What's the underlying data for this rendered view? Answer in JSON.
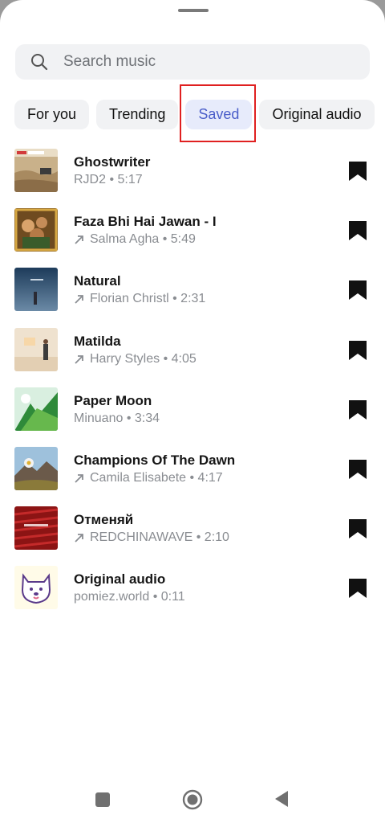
{
  "search": {
    "placeholder": "Search music",
    "icon": "search-icon"
  },
  "tabs": [
    {
      "label": "For you"
    },
    {
      "label": "Trending"
    },
    {
      "label": "Saved",
      "active": true
    },
    {
      "label": "Original audio"
    }
  ],
  "tracks": [
    {
      "title": "Ghostwriter",
      "trending": false,
      "subtitle": "RJD2 • 5:17",
      "art": "ghostwriter-cover"
    },
    {
      "title": "Faza Bhi Hai Jawan - I",
      "trending": true,
      "subtitle": "Salma Agha • 5:49",
      "art": "faza-cover"
    },
    {
      "title": "Natural",
      "trending": true,
      "subtitle": "Florian Christl • 2:31",
      "art": "natural-cover"
    },
    {
      "title": "Matilda",
      "trending": true,
      "subtitle": "Harry Styles • 4:05",
      "art": "matilda-cover"
    },
    {
      "title": "Paper Moon",
      "trending": false,
      "subtitle": "Minuano • 3:34",
      "art": "paper-moon-cover"
    },
    {
      "title": "Champions Of The Dawn",
      "trending": true,
      "subtitle": "Camila Elisabete • 4:17",
      "art": "champions-cover"
    },
    {
      "title": "Отменяй",
      "trending": true,
      "subtitle": "REDCHINAWAVE • 2:10",
      "art": "otmenyai-cover"
    },
    {
      "title": "Original audio",
      "trending": false,
      "subtitle": "pomiez.world • 0:11",
      "art": "dog-avatar-cover"
    }
  ],
  "colors": {
    "accent": "#4a5dc9",
    "active_tab_bg": "#e7ebfb",
    "chip_bg": "#f1f2f4",
    "highlight": "#e02020"
  }
}
